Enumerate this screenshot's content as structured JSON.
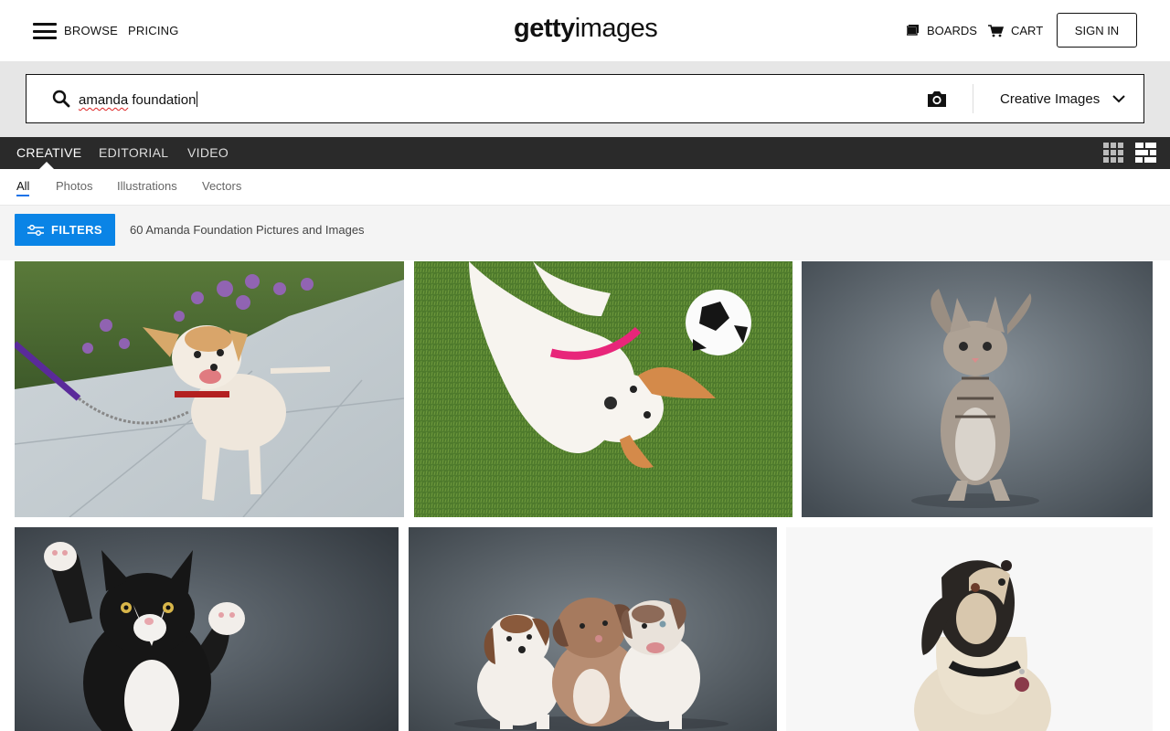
{
  "header": {
    "browse_label": "BROWSE",
    "pricing_label": "PRICING",
    "logo_bold": "getty",
    "logo_light": "images",
    "boards_label": "BOARDS",
    "cart_label": "CART",
    "signin_label": "SIGN IN"
  },
  "search": {
    "query": "amanda foundation",
    "query_misspelled_part": "amanda",
    "query_rest": " foundation",
    "type_selected": "Creative Images"
  },
  "tabs": [
    {
      "label": "CREATIVE",
      "active": true
    },
    {
      "label": "EDITORIAL",
      "active": false
    },
    {
      "label": "VIDEO",
      "active": false
    }
  ],
  "subtabs": [
    {
      "label": "All",
      "active": true
    },
    {
      "label": "Photos",
      "active": false
    },
    {
      "label": "Illustrations",
      "active": false
    },
    {
      "label": "Vectors",
      "active": false
    }
  ],
  "filters": {
    "button_label": "FILTERS",
    "result_count_text": "60 Amanda Foundation Pictures and Images"
  },
  "images": [
    {
      "subject": "chihuahua-on-leash"
    },
    {
      "subject": "dog-with-soccer-ball"
    },
    {
      "subject": "tabby-kitten-standing"
    },
    {
      "subject": "black-white-kitten-pawing"
    },
    {
      "subject": "three-puppies"
    },
    {
      "subject": "dog-looking-up"
    }
  ],
  "colors": {
    "accent_blue": "#0a84e6",
    "tabbar_bg": "#2a2a2a",
    "search_band_bg": "#e6e6e6"
  }
}
